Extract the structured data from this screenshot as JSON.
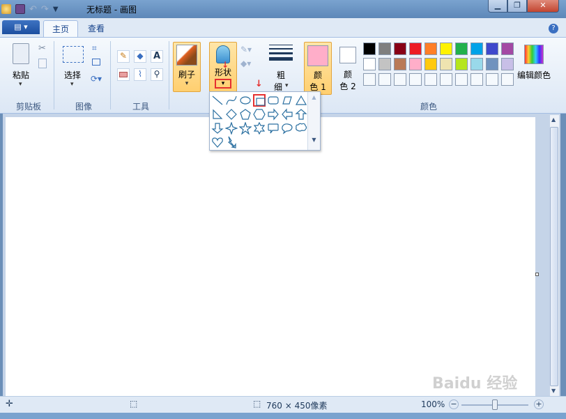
{
  "window": {
    "title": "无标题 - 画图",
    "min_label": "▁",
    "max_label": "❐",
    "close_label": "✕"
  },
  "tabs": [
    {
      "label": "主页"
    },
    {
      "label": "查看"
    }
  ],
  "help_label": "?",
  "ribbon": {
    "clipboard": {
      "paste_label": "粘贴",
      "group_label": "剪贴板"
    },
    "image": {
      "select_label": "选择",
      "group_label": "图像"
    },
    "tools": {
      "group_label": "工具",
      "text_tool": "A"
    },
    "brushes": {
      "label": "刷子"
    },
    "shapes": {
      "label": "形状"
    },
    "size": {
      "label_1": "粗",
      "label_2": "细"
    },
    "color1": {
      "label_1": "颜",
      "label_2": "色 1"
    },
    "color2": {
      "label_1": "颜",
      "label_2": "色 2"
    },
    "colors_group_label": "颜色",
    "edit_colors_label": "编辑颜色",
    "palette_row1": [
      "#000000",
      "#7f7f7f",
      "#880015",
      "#ed1c24",
      "#ff7f27",
      "#fff200",
      "#22b14c",
      "#00a2e8",
      "#3f48cc",
      "#a349a4"
    ],
    "palette_row2": [
      "#ffffff",
      "#c3c3c3",
      "#b97a57",
      "#ffaec9",
      "#ffc90e",
      "#efe4b0",
      "#b5e61d",
      "#99d9ea",
      "#7092be",
      "#c8bfe7"
    ],
    "color1_value": "#ffaec9",
    "color2_value": "#ffffff"
  },
  "shapes_gallery": {
    "row1": [
      "line-shape",
      "curve-shape",
      "oval-shape",
      "rectangle-shape",
      "rounded-rectangle-shape",
      "polygon-shape",
      "triangle-shape"
    ],
    "row2": [
      "right-triangle-shape",
      "diamond-shape",
      "pentagon-shape",
      "hexagon-shape",
      "right-arrow-shape",
      "left-arrow-shape",
      "up-arrow-shape"
    ],
    "row3": [
      "down-arrow-shape",
      "four-point-star-shape",
      "five-point-star-shape",
      "six-point-star-shape",
      "rounded-callout-shape",
      "oval-callout-shape",
      "cloud-callout-shape"
    ],
    "row4": [
      "heart-shape",
      "lightning-shape"
    ]
  },
  "status": {
    "image_size": "760 × 450像素",
    "zoom": "100%"
  },
  "watermark": "Baidu 经验"
}
